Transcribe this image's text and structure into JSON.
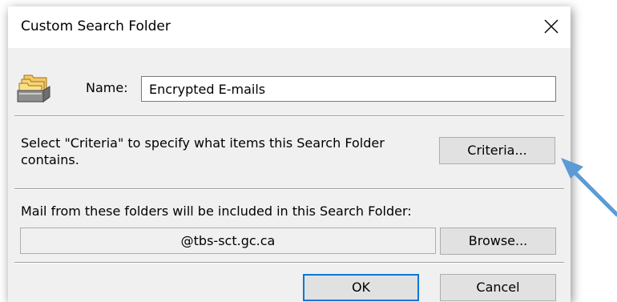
{
  "dialog": {
    "title": "Custom Search Folder",
    "close_icon": "close-icon"
  },
  "name_row": {
    "icon": "search-folder-icon",
    "label": "Name:",
    "value": "Encrypted E-mails"
  },
  "criteria": {
    "description": "Select \"Criteria\" to specify what items this Search Folder contains.",
    "button_label": "Criteria..."
  },
  "folders": {
    "label": "Mail from these folders will be included in this Search Folder:",
    "value": "@tbs-sct.gc.ca",
    "browse_label": "Browse..."
  },
  "footer": {
    "ok_label": "OK",
    "cancel_label": "Cancel"
  },
  "annotation": {
    "arrow_icon": "pointer-arrow",
    "color": "#5b9bd5"
  },
  "colors": {
    "dialog_bg": "#f0f0f0",
    "titlebar_bg": "#ffffff",
    "button_bg": "#e1e1e1",
    "default_button_border": "#0078d7"
  }
}
